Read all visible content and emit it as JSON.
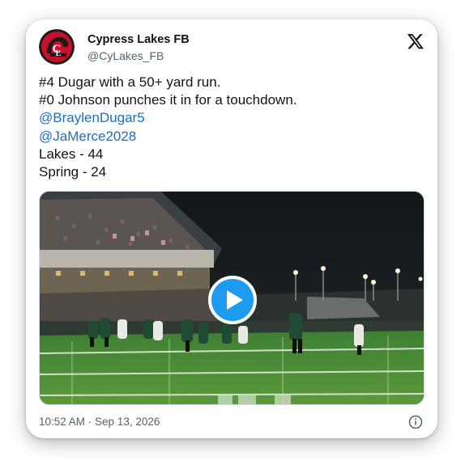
{
  "account": {
    "name": "Cypress Lakes FB",
    "handle": "@CyLakes_FB",
    "avatar_icon": "cypress-lakes-spartan-logo",
    "avatar_color": "#c8102e"
  },
  "platform_icon": "x-logo-icon",
  "tweet": {
    "lines": [
      "#4 Dugar with a 50+ yard run.",
      "#0 Johnson punches it in for a touchdown."
    ],
    "mentions": [
      "@BraylenDugar5",
      "@JaMerce2028"
    ],
    "score": [
      "Lakes - 44",
      "Spring - 24"
    ]
  },
  "media": {
    "type": "video",
    "play_icon": "play-icon",
    "accent": "#1d9bf0"
  },
  "footer": {
    "timestamp": "10:52 AM · Sep 13, 2026",
    "info_icon": "info-icon"
  },
  "colors": {
    "text": "#0f1419",
    "secondary": "#536471",
    "link": "#1d6fc2"
  }
}
